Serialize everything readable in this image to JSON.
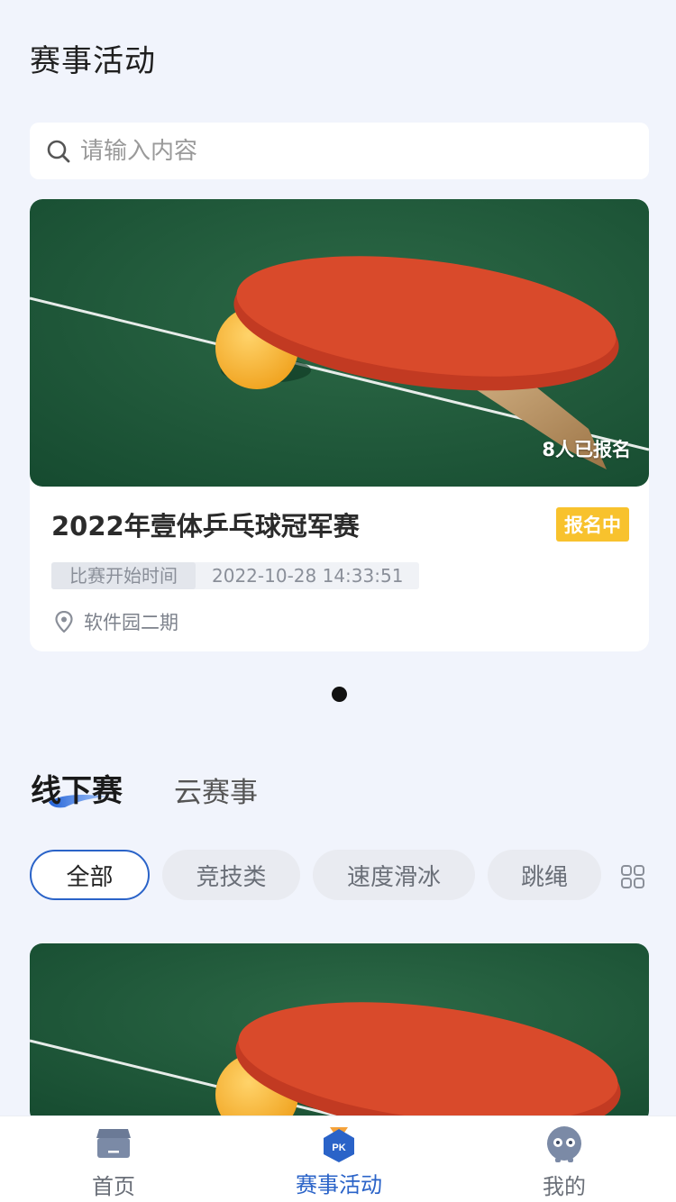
{
  "header": {
    "title": "赛事活动"
  },
  "search": {
    "placeholder": "请输入内容"
  },
  "featured": {
    "signup_count": "8人已报名",
    "title": "2022年壹体乒乓球冠军赛",
    "status": "报名中",
    "time_label": "比赛开始时间",
    "time_value": "2022-10-28 14:33:51",
    "location": "软件园二期",
    "carousel_pages": 1,
    "carousel_active": 1
  },
  "tabs": [
    {
      "label": "线下赛",
      "active": true
    },
    {
      "label": "云赛事",
      "active": false
    }
  ],
  "filters": [
    {
      "label": "全部",
      "active": true
    },
    {
      "label": "竞技类",
      "active": false
    },
    {
      "label": "速度滑冰",
      "active": false
    },
    {
      "label": "跳绳",
      "active": false
    }
  ],
  "icons": {
    "search": "search-icon",
    "location": "location-pin-icon",
    "more_categories": "grid-icon",
    "nav_home": "home-icon",
    "nav_events": "pk-icon",
    "nav_profile": "profile-icon"
  },
  "bottom_nav": [
    {
      "label": "首页",
      "active": false
    },
    {
      "label": "赛事活动",
      "active": true
    },
    {
      "label": "我的",
      "active": false
    }
  ],
  "colors": {
    "background": "#f1f4fc",
    "accent": "#2a63c8",
    "status_badge": "#f8c22d",
    "table_green": "#1f5a3a"
  }
}
